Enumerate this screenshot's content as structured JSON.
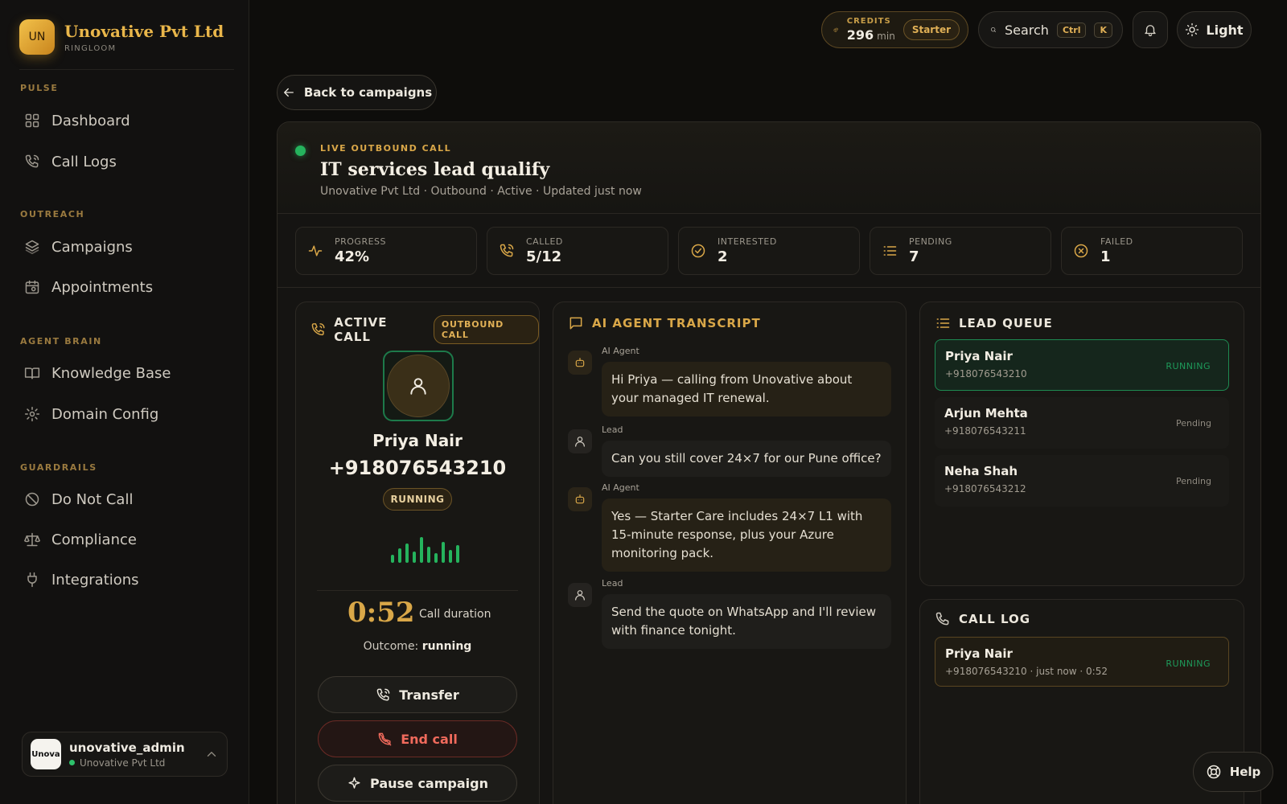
{
  "brand": {
    "logo_text": "UN",
    "name": "Unovative Pvt Ltd",
    "subtitle": "RINGLOOM"
  },
  "sidebar": {
    "sections": [
      {
        "label": "PULSE",
        "items": [
          {
            "label": "Dashboard",
            "icon": "grid-icon"
          },
          {
            "label": "Call Logs",
            "icon": "phone-icon"
          }
        ]
      },
      {
        "label": "OUTREACH",
        "items": [
          {
            "label": "Campaigns",
            "icon": "layers-icon"
          },
          {
            "label": "Appointments",
            "icon": "calendar-icon"
          }
        ]
      },
      {
        "label": "AGENT BRAIN",
        "items": [
          {
            "label": "Knowledge Base",
            "icon": "book-icon"
          },
          {
            "label": "Domain Config",
            "icon": "gear-icon"
          }
        ]
      },
      {
        "label": "GUARDRAILS",
        "items": [
          {
            "label": "Do Not Call",
            "icon": "ban-icon"
          },
          {
            "label": "Compliance",
            "icon": "scale-icon"
          },
          {
            "label": "Integrations",
            "icon": "plug-icon"
          }
        ]
      }
    ],
    "user": {
      "avatar_text": "Unova",
      "name": "unovative_admin",
      "org": "Unovative Pvt Ltd"
    }
  },
  "topbar": {
    "credits_label": "CREDITS",
    "credits_value": "296",
    "credits_unit": "min",
    "plan": "Starter",
    "search_label": "Search",
    "kbd_ctrl": "Ctrl",
    "kbd_k": "K",
    "theme_label": "Light"
  },
  "back_label": "Back to campaigns",
  "campaign": {
    "live_label": "LIVE OUTBOUND CALL",
    "title": "IT services lead qualify",
    "subtitle": "Unovative Pvt Ltd · Outbound · Active · Updated just now"
  },
  "stats": [
    {
      "label": "PROGRESS",
      "value": "42%",
      "icon": "activity-icon"
    },
    {
      "label": "CALLED",
      "value": "5/12",
      "icon": "phone-icon"
    },
    {
      "label": "INTERESTED",
      "value": "2",
      "icon": "check-circle-icon"
    },
    {
      "label": "PENDING",
      "value": "7",
      "icon": "list-icon"
    },
    {
      "label": "FAILED",
      "value": "1",
      "icon": "x-circle-icon"
    }
  ],
  "active_call": {
    "title": "ACTIVE CALL",
    "badge": "OUTBOUND CALL",
    "name": "Priya Nair",
    "phone": "+918076543210",
    "status": "RUNNING",
    "duration": "0:52",
    "duration_label": "Call duration",
    "outcome_label": "Outcome:",
    "outcome_value": "running",
    "transfer_label": "Transfer",
    "end_label": "End call",
    "pause_label": "Pause campaign"
  },
  "transcript": {
    "title": "AI AGENT TRANSCRIPT",
    "messages": [
      {
        "role": "AI Agent",
        "text": "Hi Priya — calling from Unovative about your managed IT renewal."
      },
      {
        "role": "Lead",
        "text": "Can you still cover 24×7 for our Pune office?"
      },
      {
        "role": "AI Agent",
        "text": "Yes — Starter Care includes 24×7 L1 with 15-minute response, plus your Azure monitoring pack."
      },
      {
        "role": "Lead",
        "text": "Send the quote on WhatsApp and I'll review with finance tonight."
      }
    ]
  },
  "lead_queue": {
    "title": "LEAD QUEUE",
    "items": [
      {
        "name": "Priya Nair",
        "phone": "+918076543210",
        "status": "RUNNING"
      },
      {
        "name": "Arjun Mehta",
        "phone": "+918076543211",
        "status": "Pending"
      },
      {
        "name": "Neha Shah",
        "phone": "+918076543212",
        "status": "Pending"
      }
    ]
  },
  "call_log": {
    "title": "CALL LOG",
    "items": [
      {
        "name": "Priya Nair",
        "meta": "+918076543210 · just now · 0:52",
        "status": "RUNNING"
      }
    ]
  },
  "help_label": "Help",
  "colors": {
    "accent": "#d9a748",
    "live": "#25b35d",
    "danger": "#f06a5c",
    "background": "#0e0d0b"
  }
}
